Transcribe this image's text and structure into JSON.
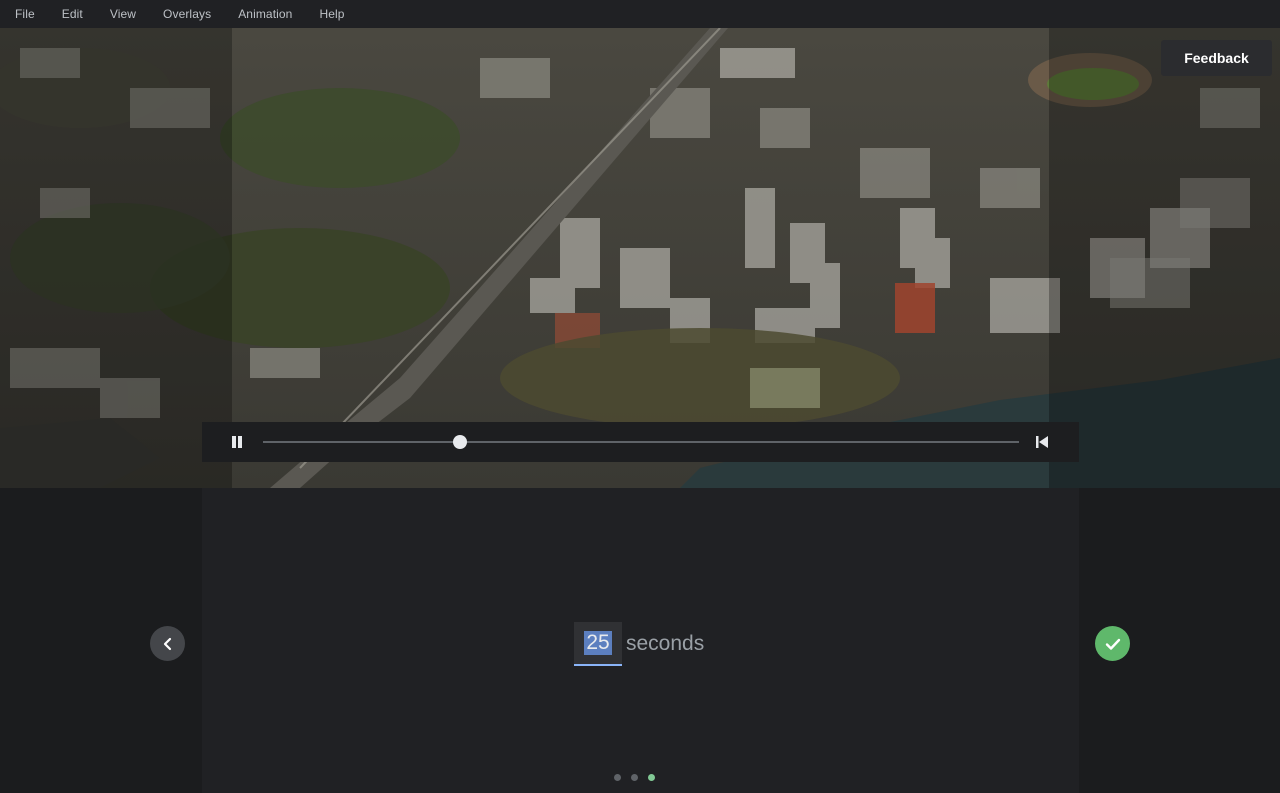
{
  "menu": {
    "items": [
      "File",
      "Edit",
      "View",
      "Overlays",
      "Animation",
      "Help"
    ]
  },
  "viewport": {
    "icon": "aerial-city-view"
  },
  "feedback": {
    "label": "Feedback"
  },
  "playback": {
    "progress": 0.26,
    "pause_icon": "pause-icon",
    "skip_icon": "skip-to-start-icon"
  },
  "duration": {
    "value": "25",
    "unit": "seconds"
  },
  "pager": {
    "count": 3,
    "active_index": 2,
    "active_color": "#81c995",
    "inactive_color": "#5f6368"
  },
  "nav": {
    "back_icon": "chevron-left-icon",
    "confirm_icon": "checkmark-icon",
    "confirm_color": "#5fb86b"
  }
}
